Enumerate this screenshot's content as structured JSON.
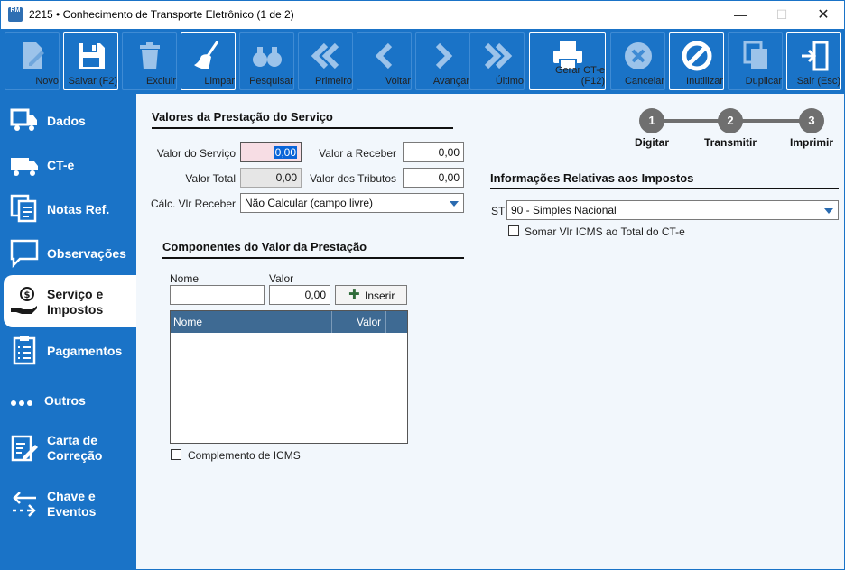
{
  "window": {
    "title": "2215 • Conhecimento de Transporte Eletrônico (1 de 2)",
    "min_symbol": "—",
    "max_symbol": "☐",
    "close_symbol": "✕",
    "app_icon_text": "RM"
  },
  "toolbar": {
    "buttons": [
      {
        "label": "Novo",
        "icon": "new-document-icon",
        "enabled": false
      },
      {
        "label": "Salvar (F2)",
        "icon": "floppy-disk-icon",
        "enabled": true
      },
      {
        "label": "Excluir",
        "icon": "trash-icon",
        "enabled": false
      },
      {
        "label": "Limpar",
        "icon": "broom-icon",
        "enabled": true
      },
      {
        "label": "Pesquisar",
        "icon": "binoculars-icon",
        "enabled": false
      },
      {
        "label": "Primeiro",
        "icon": "double-chevron-left-icon",
        "enabled": false
      },
      {
        "label": "Voltar",
        "icon": "chevron-left-icon",
        "enabled": false
      },
      {
        "label": "Avançar",
        "icon": "chevron-right-icon",
        "enabled": false
      },
      {
        "label": "Último",
        "icon": "double-chevron-right-icon",
        "enabled": false
      },
      {
        "label": "Gerar CT-e (F12)",
        "icon": "printer-icon",
        "enabled": true
      },
      {
        "label": "Cancelar",
        "icon": "cancel-circle-icon",
        "enabled": false
      },
      {
        "label": "Inutilizar",
        "icon": "prohibited-icon",
        "enabled": true
      },
      {
        "label": "Duplicar",
        "icon": "duplicate-icon",
        "enabled": false
      },
      {
        "label": "Sair (Esc)",
        "icon": "exit-door-icon",
        "enabled": true
      }
    ]
  },
  "sidebar": {
    "items": [
      {
        "label_line1": "Dados",
        "label_line2": "",
        "icon": "truck-box-icon",
        "selected": false
      },
      {
        "label_line1": "CT-e",
        "label_line2": "",
        "icon": "truck-icon",
        "selected": false
      },
      {
        "label_line1": "Notas Ref.",
        "label_line2": "",
        "icon": "documents-icon",
        "selected": false
      },
      {
        "label_line1": "Observações",
        "label_line2": "",
        "icon": "speech-bubble-icon",
        "selected": false
      },
      {
        "label_line1": "Serviço e",
        "label_line2": "Impostos",
        "icon": "coin-hand-icon",
        "selected": true
      },
      {
        "label_line1": "Pagamentos",
        "label_line2": "",
        "icon": "clipboard-list-icon",
        "selected": false
      },
      {
        "label_line1": "Outros",
        "label_line2": "",
        "icon": "dots-icon",
        "selected": false
      },
      {
        "label_line1": "Carta de",
        "label_line2": "Correção",
        "icon": "edit-document-icon",
        "selected": false
      },
      {
        "label_line1": "Chave e",
        "label_line2": "Eventos",
        "icon": "arrows-exchange-icon",
        "selected": false
      }
    ]
  },
  "prestacao": {
    "section_title": "Valores da Prestação do Serviço",
    "valor_servico_label": "Valor do Serviço",
    "valor_servico_value": "0,00",
    "valor_receber_label": "Valor a Receber",
    "valor_receber_value": "0,00",
    "valor_total_label": "Valor Total",
    "valor_total_value": "0,00",
    "valor_tributos_label": "Valor dos Tributos",
    "valor_tributos_value": "0,00",
    "calc_receber_label": "Cálc. Vlr Receber",
    "calc_receber_value": "Não Calcular (campo livre)"
  },
  "componentes": {
    "section_title": "Componentes do Valor da Prestação",
    "nome_label": "Nome",
    "nome_value": "",
    "valor_label": "Valor",
    "valor_value": "0,00",
    "insert_label": "Inserir",
    "col_nome": "Nome",
    "col_valor": "Valor",
    "complemento_label": "Complemento de ICMS",
    "complemento_checked": false
  },
  "impostos": {
    "section_title": "Informações Relativas aos Impostos",
    "st_label": "ST",
    "st_value": "90 - Simples Nacional",
    "somar_label": "Somar Vlr ICMS ao Total do CT-e",
    "somar_checked": false
  },
  "steps": [
    {
      "number": "1",
      "label": "Digitar"
    },
    {
      "number": "2",
      "label": "Transmitir"
    },
    {
      "number": "3",
      "label": "Imprimir"
    }
  ],
  "colors": {
    "accent": "#1a73c7",
    "grid_header": "#3e6a93",
    "step_gray": "#6f6f6f",
    "main_bg": "#f2f7fc"
  }
}
